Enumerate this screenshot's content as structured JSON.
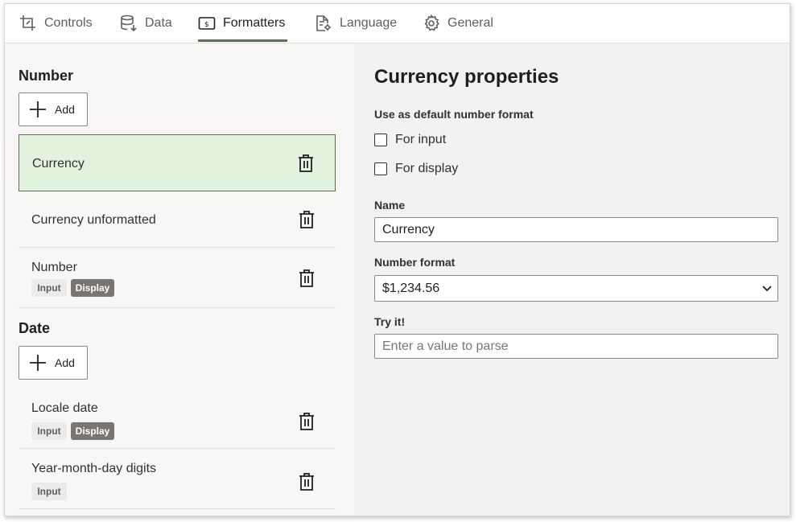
{
  "tabs": [
    {
      "label": "Controls",
      "icon": "crop-icon"
    },
    {
      "label": "Data",
      "icon": "database-icon"
    },
    {
      "label": "Formatters",
      "icon": "currency-format-icon"
    },
    {
      "label": "Language",
      "icon": "document-settings-icon"
    },
    {
      "label": "General",
      "icon": "gear-icon"
    }
  ],
  "active_tab": "Formatters",
  "accent_color": "#5b7345",
  "selected_bg": "#e1f3dc",
  "number_section": {
    "title": "Number",
    "add_label": "Add",
    "items": [
      {
        "label": "Currency",
        "selected": true
      },
      {
        "label": "Currency unformatted"
      },
      {
        "label": "Number",
        "badges": [
          "Input",
          "Display"
        ]
      }
    ]
  },
  "date_section": {
    "title": "Date",
    "add_label": "Add",
    "items": [
      {
        "label": "Locale date",
        "badges": [
          "Input",
          "Display"
        ]
      },
      {
        "label": "Year-month-day digits",
        "badges": [
          "Input"
        ]
      }
    ]
  },
  "properties": {
    "title": "Currency properties",
    "default_format_label": "Use as default number format",
    "for_input_label": "For input",
    "for_input_checked": false,
    "for_display_label": "For display",
    "for_display_checked": false,
    "name_label": "Name",
    "name_value": "Currency",
    "number_format_label": "Number format",
    "number_format_value": "$1,234.56",
    "try_label": "Try it!",
    "try_placeholder": "Enter a value to parse"
  }
}
